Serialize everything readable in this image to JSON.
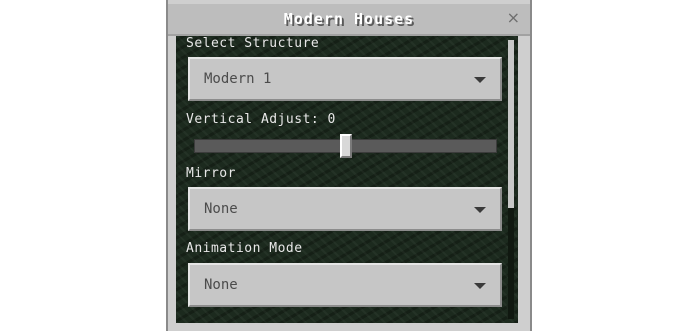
{
  "window": {
    "title": "Modern Houses",
    "close_glyph": "×"
  },
  "fields": {
    "structure": {
      "label": "Select Structure",
      "value": "Modern 1"
    },
    "vertical_adjust": {
      "label": "Vertical Adjust: 0",
      "value": 0,
      "min": -10,
      "max": 10
    },
    "mirror": {
      "label": "Mirror",
      "value": "None"
    },
    "animation_mode": {
      "label": "Animation Mode",
      "value": "None"
    }
  },
  "icons": {
    "close": "close-icon",
    "dropdown": "chevron-down-icon"
  },
  "colors": {
    "panel": "#cfcfcf",
    "content_bg": "#1c2a1e",
    "control": "#c6c6c6"
  }
}
